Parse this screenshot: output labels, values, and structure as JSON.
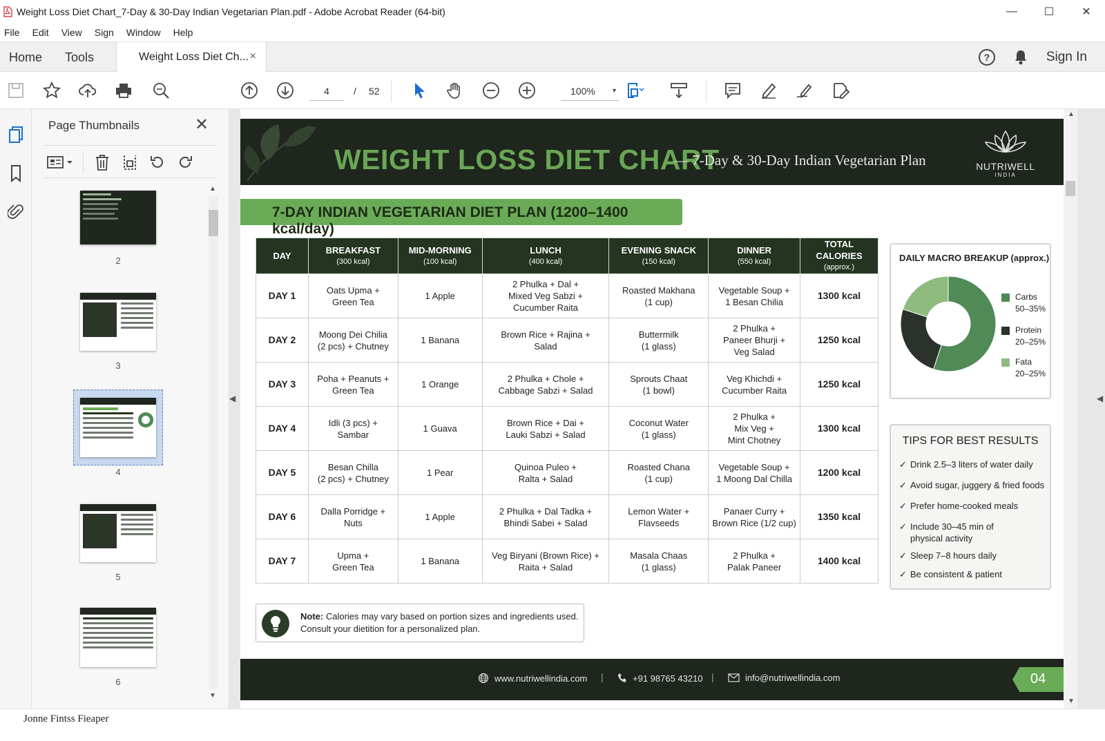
{
  "window": {
    "title": "Weight Loss Diet Chart_7-Day & 30-Day Indian Vegetarian Plan.pdf - Adobe Acrobat Reader (64-bit)",
    "controls": {
      "minimize": "—",
      "maximize": "☐",
      "close": "✕"
    }
  },
  "menu": [
    "File",
    "Edit",
    "View",
    "Sign",
    "Window",
    "Help"
  ],
  "tabs": {
    "home": "Home",
    "tools": "Tools",
    "document": "Weight Loss Diet Ch...",
    "close": "×",
    "help": "?",
    "sign_in": "Sign In"
  },
  "toolbar": {
    "current_page": "4",
    "page_separator": "/",
    "total_pages": "52",
    "zoom": "100%",
    "zoom_arrow": "▾"
  },
  "thumbnails": {
    "title": "Page Thumbnails",
    "close": "✕",
    "pages": [
      "2",
      "3",
      "4",
      "5",
      "6"
    ],
    "selected_page": "4"
  },
  "document": {
    "banner_title": "WEIGHT LOSS DIET CHART",
    "banner_subtitle": "— 7-Day & 30-Day Indian Vegetarian Plan",
    "brand_name": "NUTRIWELL",
    "brand_sub": "INDIA",
    "plan_header": "7-DAY INDIAN VEGETARIAN DIET PLAN (1200–1400 kcal/day)",
    "table": {
      "headers": [
        {
          "main": "DAY",
          "sub": ""
        },
        {
          "main": "BREAKFAST",
          "sub": "(300 kcal)"
        },
        {
          "main": "MID-MORNING",
          "sub": "(100 kcal)"
        },
        {
          "main": "LUNCH",
          "sub": "(400 kcal)"
        },
        {
          "main": "EVENING SNACK",
          "sub": "(150 kcal)"
        },
        {
          "main": "DINNER",
          "sub": "(550 kcal)"
        },
        {
          "main": "TOTAL CALORIES",
          "sub": "(approx.)"
        }
      ],
      "rows": [
        [
          "DAY 1",
          "Oats Upma +\nGreen Tea",
          "1 Apple",
          "2 Phulka + Dal +\nMixed Veg Sabzi +\nCucumber Raita",
          "Roasted Makhana\n(1 cup)",
          "Vegetable Soup +\n1 Besan Chilia",
          "1300 kcal"
        ],
        [
          "DAY 2",
          "Moong Dei Chilia\n(2 pcs) + Chutney",
          "1 Banana",
          "Brown Rice + Rajina +\nSalad",
          "Buttermilk\n(1 glass)",
          "2 Phulka +\nPaneer Bhurji +\nVeg Salad",
          "1250 kcal"
        ],
        [
          "DAY 3",
          "Poha + Peanuts +\nGreen Tea",
          "1 Orange",
          "2 Phulka + Chole +\nCabbage Sabzi + Salad",
          "Sprouts Chaat\n(1 bowl)",
          "Veg Khichdi +\nCucumber Raita",
          "1250 kcal"
        ],
        [
          "DAY 4",
          "Idli (3 pcs) +\nSambar",
          "1 Guava",
          "Brown Rice + Dai +\nLauki Sabzi + Salad",
          "Coconut Water\n(1 glass)",
          "2 Phulka +\nMix Veg +\nMint Chotney",
          "1300 kcal"
        ],
        [
          "DAY 5",
          "Besan Chilla\n(2 pcs) + Chutney",
          "1 Pear",
          "Quinoa Puleo +\nRalta + Salad",
          "Roasted Chana\n(1 cup)",
          "Vegetable Soup +\n1 Moong Dal Chilla",
          "1200 kcal"
        ],
        [
          "DAY 6",
          "Dalla Porridge +\nNuts",
          "1 Apple",
          "2 Phulka + Dal Tadka +\nBhindi Sabei + Salad",
          "Lemon Water +\nFlavseeds",
          "Panaer Curry +\nBrown Rice (1/2 cup)",
          "1350 kcal"
        ],
        [
          "DAY 7",
          "Upma +\nGreen Tea",
          "1 Banana",
          "Veg Biryani (Brown Rice) +\nRaita + Salad",
          "Masala Chaas\n(1 glass)",
          "2 Phulka +\nPalak Paneer",
          "1400 kcal"
        ]
      ]
    },
    "macro": {
      "title": "DAILY MACRO BREAKUP (approx.)",
      "items": [
        {
          "name": "Carbs",
          "range": "50–35%",
          "color": "#4f8a57",
          "share": 0.55
        },
        {
          "name": "Protein",
          "range": "20–25%",
          "color": "#2b322b",
          "share": 0.25
        },
        {
          "name": "Fata",
          "range": "20–25%",
          "color": "#8fbb7f",
          "share": 0.2
        }
      ]
    },
    "tips": {
      "title": "TIPS FOR BEST RESULTS",
      "items": [
        "Drink 2.5–3 liters of water daily",
        "Avoid sugar, juggery & fried foods",
        "Prefer home-cooked meals",
        "Include 30–45 min of\nphysical activity",
        "Sleep 7–8 hours daily",
        "Be consistent & patient"
      ]
    },
    "note": {
      "label": "Note:",
      "line1": " Calories may vary based on portion sizes and ingredients used.",
      "line2": "Consult your dietition for a personalized plan."
    },
    "footer": {
      "website": "www.nutriwellindia.com",
      "phone": "+91 98765 43210",
      "email": "info@nutriwellindia.com",
      "separator": "|",
      "page_number": "04"
    }
  },
  "statusbar": "Jonne Fintss Fieaper",
  "colors": {
    "banner_bg": "#1e261d",
    "accent_green": "#6aab57",
    "table_header": "#243420"
  }
}
